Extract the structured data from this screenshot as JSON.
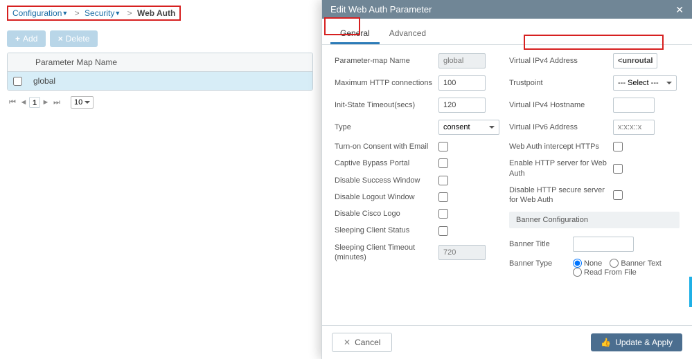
{
  "breadcrumb": {
    "c1": "Configuration",
    "c2": "Security",
    "current": "Web Auth"
  },
  "buttons": {
    "add": "Add",
    "delete": "Delete"
  },
  "table": {
    "header": "Parameter Map Name",
    "rows": [
      "global"
    ]
  },
  "pager": {
    "page": "1",
    "size": "10"
  },
  "panel": {
    "title": "Edit Web Auth Parameter",
    "tabs": {
      "general": "General",
      "advanced": "Advanced"
    },
    "left": {
      "param_name": {
        "label": "Parameter-map Name",
        "value": "global"
      },
      "max_http": {
        "label": "Maximum HTTP connections",
        "value": "100"
      },
      "init_to": {
        "label": "Init-State Timeout(secs)",
        "value": "120"
      },
      "type": {
        "label": "Type",
        "value": "consent"
      },
      "consent_email": {
        "label": "Turn-on Consent with Email"
      },
      "captive": {
        "label": "Captive Bypass Portal"
      },
      "dis_success": {
        "label": "Disable Success Window"
      },
      "dis_logout": {
        "label": "Disable Logout Window"
      },
      "dis_logo": {
        "label": "Disable Cisco Logo"
      },
      "sleep_status": {
        "label": "Sleeping Client Status"
      },
      "sleep_to": {
        "label": "Sleeping Client Timeout (minutes)",
        "value": "720"
      }
    },
    "right": {
      "v4addr": {
        "label": "Virtual IPv4 Address",
        "value": "<unroutable-ip>"
      },
      "trustpoint": {
        "label": "Trustpoint",
        "value": "--- Select ---"
      },
      "v4host": {
        "label": "Virtual IPv4 Hostname",
        "value": ""
      },
      "v6addr": {
        "label": "Virtual IPv6 Address",
        "placeholder": "x:x:x::x"
      },
      "intercept": {
        "label": "Web Auth intercept HTTPs"
      },
      "enable_http": {
        "label": "Enable HTTP server for Web Auth"
      },
      "disable_https": {
        "label": "Disable HTTP secure server for Web Auth"
      },
      "banner_section": "Banner Configuration",
      "banner_title": {
        "label": "Banner Title",
        "value": ""
      },
      "banner_type": {
        "label": "Banner Type",
        "none": "None",
        "text": "Banner Text",
        "file": "Read From File"
      }
    },
    "footer": {
      "cancel": "Cancel",
      "apply": "Update & Apply"
    }
  }
}
